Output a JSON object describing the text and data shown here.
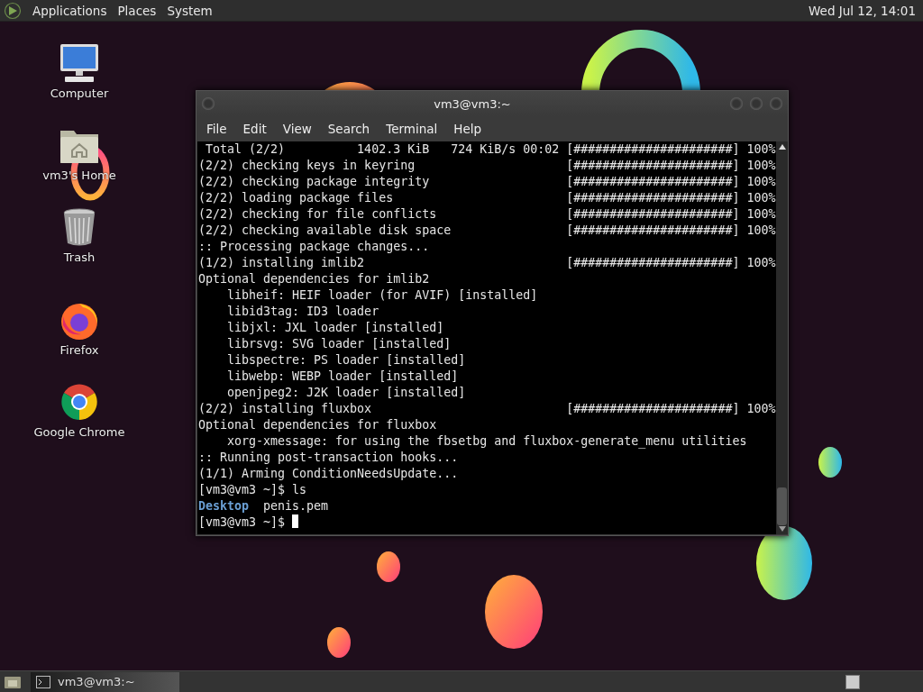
{
  "top_panel": {
    "menus": [
      "Applications",
      "Places",
      "System"
    ],
    "clock": "Wed Jul 12, 14:01"
  },
  "desktop_icons": [
    {
      "label": "Computer",
      "kind": "computer"
    },
    {
      "label": "vm3's Home",
      "kind": "home"
    },
    {
      "label": "Trash",
      "kind": "trash"
    },
    {
      "label": "Firefox",
      "kind": "firefox"
    },
    {
      "label": "Google Chrome",
      "kind": "chrome"
    }
  ],
  "window": {
    "title": "vm3@vm3:~",
    "menu": [
      "File",
      "Edit",
      "View",
      "Search",
      "Terminal",
      "Help"
    ],
    "lines": [
      {
        "text": " Total (2/2)          1402.3 KiB   724 KiB/s 00:02",
        "progress": "[######################] 100%"
      },
      {
        "text": "(2/2) checking keys in keyring",
        "progress": "[######################] 100%"
      },
      {
        "text": "(2/2) checking package integrity",
        "progress": "[######################] 100%"
      },
      {
        "text": "(2/2) loading package files",
        "progress": "[######################] 100%"
      },
      {
        "text": "(2/2) checking for file conflicts",
        "progress": "[######################] 100%"
      },
      {
        "text": "(2/2) checking available disk space",
        "progress": "[######################] 100%"
      },
      {
        "text": ":: Processing package changes..."
      },
      {
        "text": "(1/2) installing imlib2",
        "progress": "[######################] 100%"
      },
      {
        "text": "Optional dependencies for imlib2"
      },
      {
        "text": "    libheif: HEIF loader (for AVIF) [installed]"
      },
      {
        "text": "    libid3tag: ID3 loader"
      },
      {
        "text": "    libjxl: JXL loader [installed]"
      },
      {
        "text": "    librsvg: SVG loader [installed]"
      },
      {
        "text": "    libspectre: PS loader [installed]"
      },
      {
        "text": "    libwebp: WEBP loader [installed]"
      },
      {
        "text": "    openjpeg2: J2K loader [installed]"
      },
      {
        "text": "(2/2) installing fluxbox",
        "progress": "[######################] 100%"
      },
      {
        "text": "Optional dependencies for fluxbox"
      },
      {
        "text": "    xorg-xmessage: for using the fbsetbg and fluxbox-generate_menu utilities"
      },
      {
        "text": ":: Running post-transaction hooks..."
      },
      {
        "text": "(1/1) Arming ConditionNeedsUpdate..."
      },
      {
        "text": "[vm3@vm3 ~]$ ls"
      },
      {
        "parts": [
          {
            "text": "Desktop",
            "kind": "directory"
          },
          {
            "text": "  penis.pem",
            "kind": "file"
          }
        ]
      },
      {
        "text": "[vm3@vm3 ~]$ ",
        "cursor": true
      }
    ]
  },
  "taskbar": {
    "tasks": [
      {
        "label": "vm3@vm3:~",
        "selected": true
      }
    ]
  }
}
